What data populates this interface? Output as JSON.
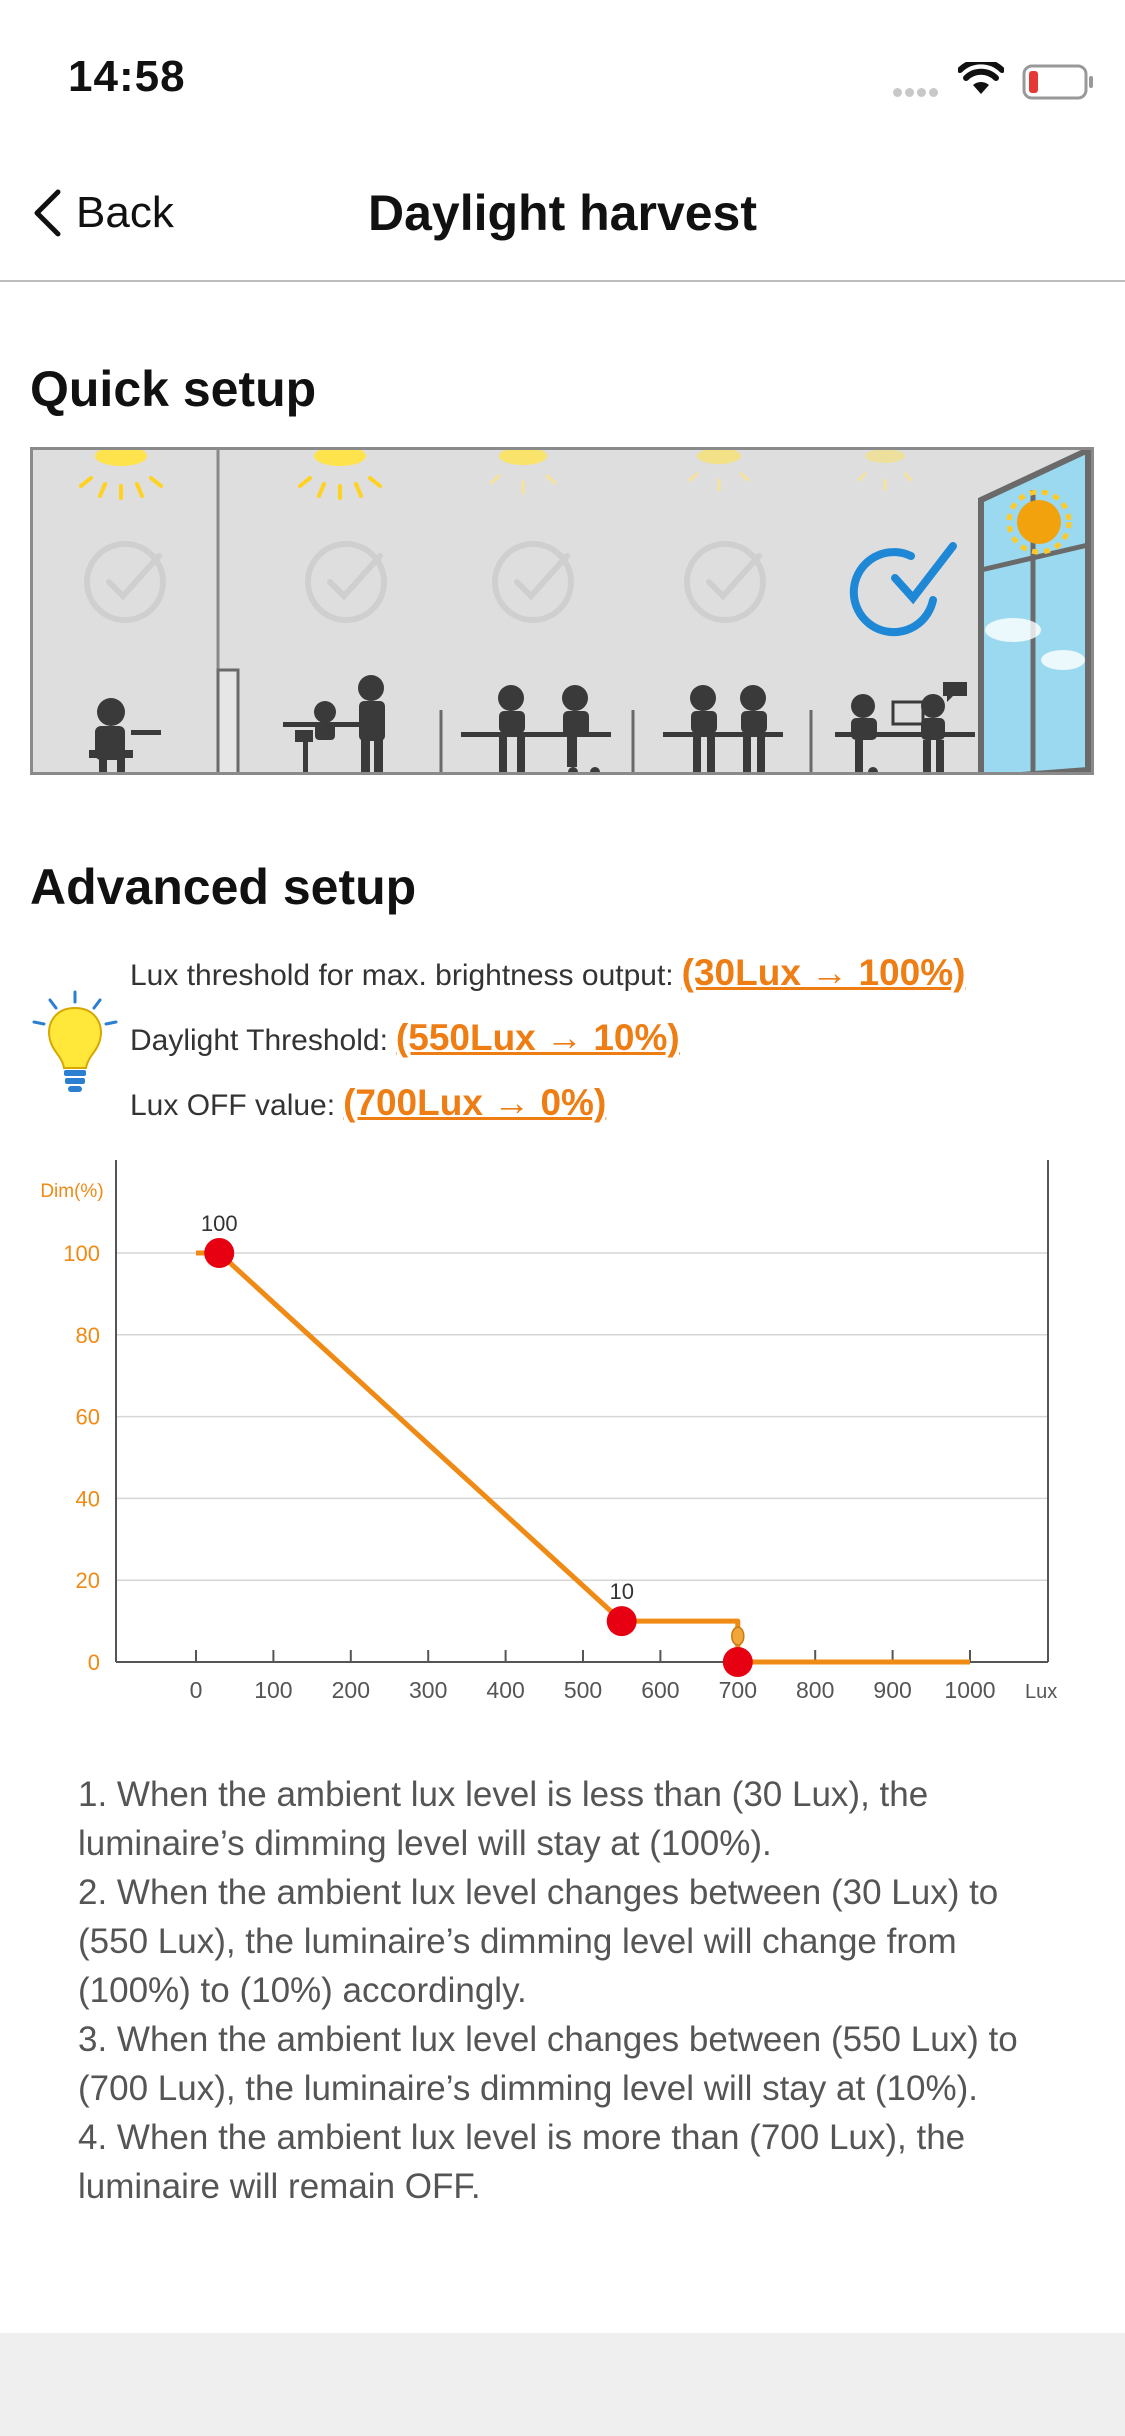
{
  "status": {
    "time": "14:58",
    "colors": {
      "battery_low": "#e53935"
    }
  },
  "nav": {
    "back_label": "Back",
    "title": "Daylight harvest"
  },
  "quick_setup": {
    "title": "Quick setup",
    "scenes": [
      {
        "name": "single-person-office",
        "selected": false
      },
      {
        "name": "small-meeting",
        "selected": false
      },
      {
        "name": "open-office",
        "selected": false
      },
      {
        "name": "desk-pair",
        "selected": false
      },
      {
        "name": "window-desk",
        "selected": true
      }
    ],
    "colors": {
      "check_selected": "#1e88d6",
      "lamp": "#ffe34d",
      "window": "#8fd3ee"
    }
  },
  "advanced_setup": {
    "title": "Advanced setup",
    "rows": [
      {
        "label": "Lux threshold for max. brightness output:",
        "value": "(30Lux → 100%)"
      },
      {
        "label": "Daylight Threshold:",
        "value": "(550Lux → 10%)"
      },
      {
        "label": "Lux OFF value:",
        "value": "(700Lux → 0%)"
      }
    ],
    "accent": "#ee7d14"
  },
  "chart_data": {
    "type": "line",
    "ylabel": "Dim(%)",
    "xunit": "Lux",
    "x_ticks": [
      0,
      100,
      200,
      300,
      400,
      500,
      600,
      700,
      800,
      900,
      1000
    ],
    "y_ticks": [
      0,
      20,
      40,
      60,
      80,
      100
    ],
    "xlim": [
      0,
      1000
    ],
    "ylim": [
      0,
      100
    ],
    "series": [
      {
        "x": [
          0,
          30,
          550,
          700,
          700,
          1000
        ],
        "y": [
          100,
          100,
          10,
          10,
          0,
          0
        ]
      }
    ],
    "control_points": [
      {
        "x": 30,
        "y": 100,
        "label": "100"
      },
      {
        "x": 550,
        "y": 10,
        "label": "10"
      },
      {
        "x": 700,
        "y": 0,
        "label": ""
      }
    ],
    "grid": true,
    "colors": {
      "line": "#ef8a14",
      "point": "#e60012",
      "tick_label": "#ef8a14"
    }
  },
  "notes": [
    "1. When the ambient lux level is less than (30 Lux), the luminaire’s dimming level will stay at (100%).",
    "2. When the ambient lux level changes between (30 Lux) to (550 Lux), the luminaire’s dimming level will change from (100%) to (10%) accordingly.",
    "3. When the ambient lux level changes between (550 Lux) to (700 Lux), the luminaire’s dimming level will stay at (10%).",
    "4. When the ambient lux level is more than (700 Lux), the luminaire will remain OFF."
  ]
}
